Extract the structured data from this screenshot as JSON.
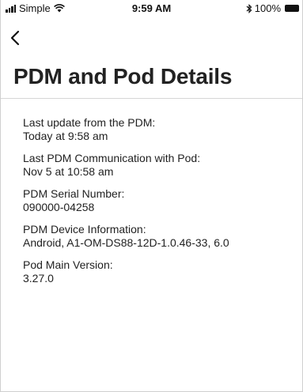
{
  "status_bar": {
    "carrier": "Simple",
    "time": "9:59 AM",
    "battery": "100%"
  },
  "header": {
    "title": "PDM and Pod Details"
  },
  "details": [
    {
      "label": "Last update from the PDM:",
      "value": "Today at 9:58 am"
    },
    {
      "label": "Last PDM Communication with Pod:",
      "value": "Nov 5 at 10:58 am"
    },
    {
      "label": "PDM Serial Number:",
      "value": "090000-04258"
    },
    {
      "label": "PDM Device Information:",
      "value": "Android, A1-OM-DS88-12D-1.0.46-33, 6.0"
    },
    {
      "label": "Pod Main Version:",
      "value": "3.27.0"
    }
  ]
}
